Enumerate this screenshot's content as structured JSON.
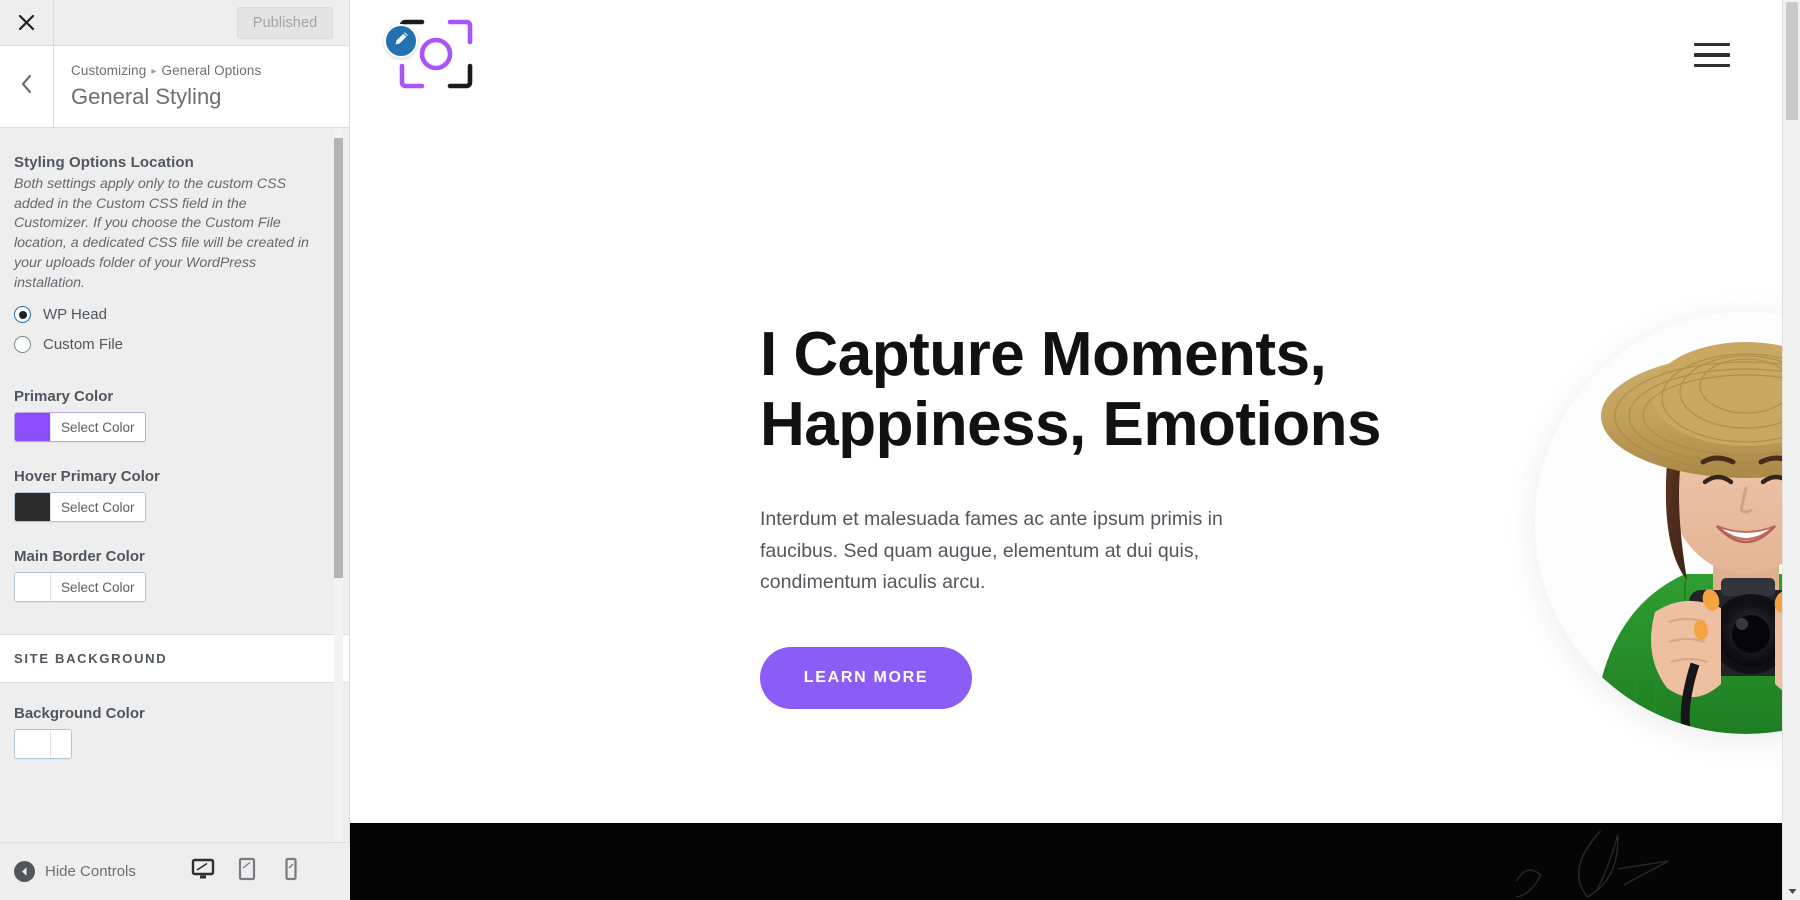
{
  "customizer": {
    "close_icon": "close-icon",
    "published_label": "Published",
    "back_icon": "chevron-left-icon",
    "breadcrumb_root": "Customizing",
    "breadcrumb_separator": "▸",
    "breadcrumb_current": "General Options",
    "panel_title": "General Styling",
    "controls": {
      "styling_location": {
        "label": "Styling Options Location",
        "description": "Both settings apply only to the custom CSS added in the Custom CSS field in the Customizer. If you choose the Custom File location, a dedicated CSS file will be created in your uploads folder of your WordPress installation.",
        "options": [
          {
            "label": "WP Head",
            "checked": true
          },
          {
            "label": "Custom File",
            "checked": false
          }
        ]
      },
      "primary_color": {
        "label": "Primary Color",
        "button_label": "Select Color",
        "value": "#8b4dff"
      },
      "hover_primary_color": {
        "label": "Hover Primary Color",
        "button_label": "Select Color",
        "value": "#2b2b2b"
      },
      "main_border_color": {
        "label": "Main Border Color",
        "button_label": "Select Color",
        "value": "#ffffff"
      },
      "site_background_section": "SITE BACKGROUND",
      "background_color": {
        "label": "Background Color"
      }
    },
    "footer": {
      "hide_controls_label": "Hide Controls",
      "hide_controls_icon": "arrow-left-circle-icon",
      "devices": [
        {
          "name": "desktop-preview",
          "icon": "desktop-icon",
          "active": true
        },
        {
          "name": "tablet-preview",
          "icon": "tablet-icon",
          "active": false
        },
        {
          "name": "mobile-preview",
          "icon": "mobile-icon",
          "active": false
        }
      ]
    }
  },
  "preview": {
    "logo": {
      "icon": "camera-frame-logo-icon",
      "bracket_dark": "#1b1b1b",
      "bracket_accent": "#a855f7",
      "circle_color": "#a855f7"
    },
    "edit_badge_icon": "pencil-edit-icon",
    "menu_icon": "hamburger-menu-icon",
    "hero": {
      "heading_line1": "I Capture Moments,",
      "heading_line2": "Happiness, Emotions",
      "paragraph": "Interdum et malesuada fames ac ante ipsum primis in faucibus. Sed quam augue, elementum at dui quis, condimentum iaculis arcu.",
      "cta_label": "LEARN MORE",
      "cta_color": "#8b5cf6",
      "photo_alt": "smiling-photographer-portrait"
    },
    "footer_band_color": "#050505"
  }
}
